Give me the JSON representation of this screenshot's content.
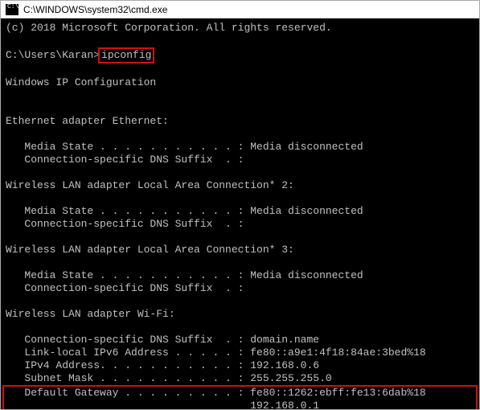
{
  "window": {
    "icon_glyph": "C:\\",
    "title": "C:\\WINDOWS\\system32\\cmd.exe"
  },
  "terminal": {
    "copyright": "(c) 2018 Microsoft Corporation. All rights reserved.",
    "prompt": "C:\\Users\\Karan>",
    "command": "ipconfig",
    "header": "Windows IP Configuration",
    "sections": [
      {
        "title": "Ethernet adapter Ethernet:",
        "lines": [
          "   Media State . . . . . . . . . . . : Media disconnected",
          "   Connection-specific DNS Suffix  . :"
        ]
      },
      {
        "title": "Wireless LAN adapter Local Area Connection* 2:",
        "lines": [
          "   Media State . . . . . . . . . . . : Media disconnected",
          "   Connection-specific DNS Suffix  . :"
        ]
      },
      {
        "title": "Wireless LAN adapter Local Area Connection* 3:",
        "lines": [
          "   Media State . . . . . . . . . . . : Media disconnected",
          "   Connection-specific DNS Suffix  . :"
        ]
      },
      {
        "title": "Wireless LAN adapter Wi-Fi:",
        "lines": [
          "   Connection-specific DNS Suffix  . : domain.name",
          "   Link-local IPv6 Address . . . . . : fe80::a9e1:4f18:84ae:3bed%18",
          "   IPv4 Address. . . . . . . . . . . : 192.168.0.6",
          "   Subnet Mask . . . . . . . . . . . : 255.255.255.0"
        ],
        "highlighted": [
          "   Default Gateway . . . . . . . . . : fe80::1262:ebff:fe13:6dab%18",
          "                                       192.168.0.1"
        ]
      }
    ]
  }
}
